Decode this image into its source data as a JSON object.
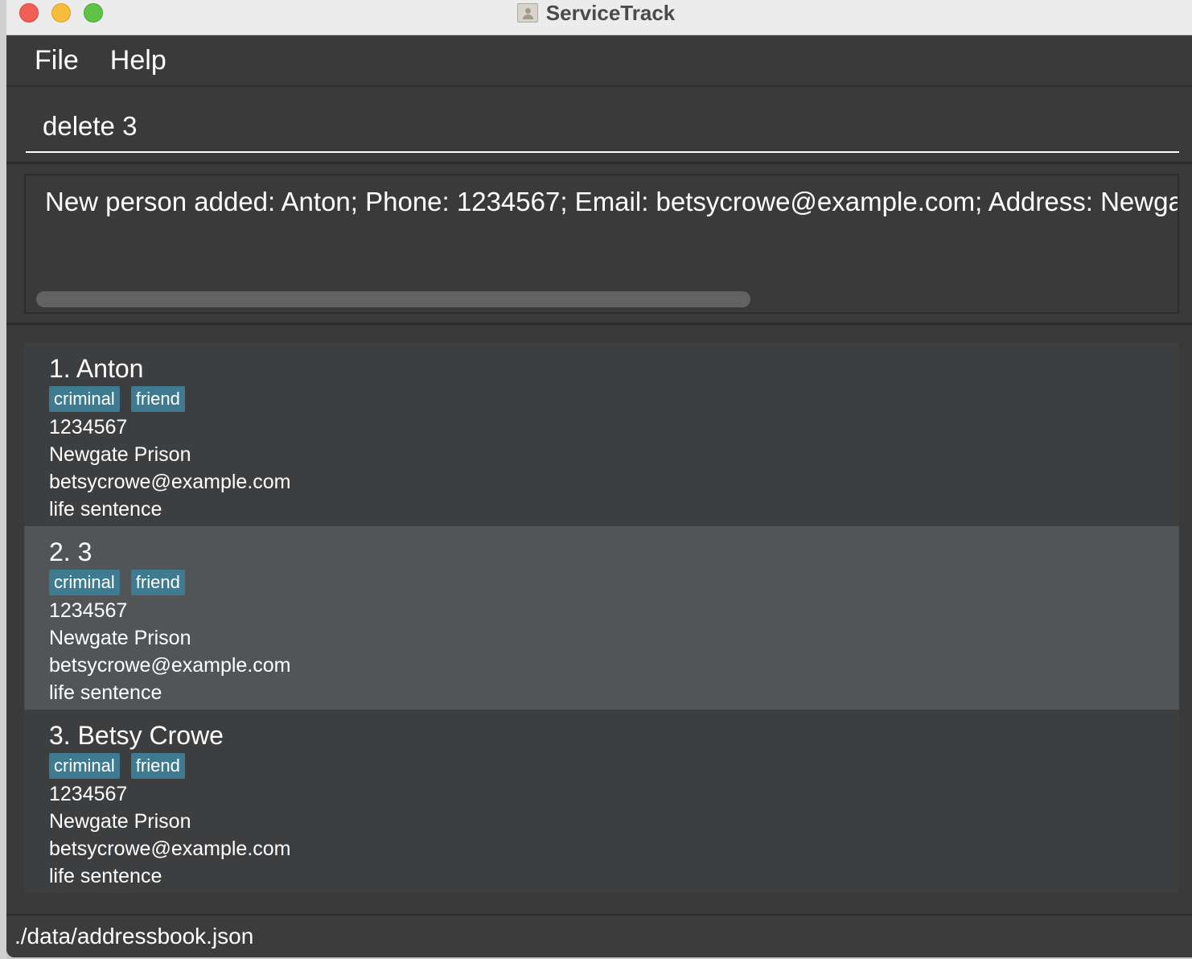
{
  "window": {
    "title": "ServiceTrack",
    "icon": "contacts-app-icon"
  },
  "menu": {
    "file": "File",
    "help": "Help"
  },
  "command": {
    "value": "delete 3"
  },
  "result": {
    "text": "New person added: Anton; Phone: 1234567; Email: betsycrowe@example.com; Address: Newgate Prison; Tags: [criminal][friend]"
  },
  "persons": [
    {
      "name": "1. Anton",
      "tags": [
        "criminal",
        "friend"
      ],
      "phone": "1234567",
      "address": "Newgate Prison",
      "email": "betsycrowe@example.com",
      "remark": "life sentence"
    },
    {
      "name": "2. 3",
      "tags": [
        "criminal",
        "friend"
      ],
      "phone": "1234567",
      "address": "Newgate Prison",
      "email": "betsycrowe@example.com",
      "remark": "life sentence"
    },
    {
      "name": "3. Betsy Crowe",
      "tags": [
        "criminal",
        "friend"
      ],
      "phone": "1234567",
      "address": "Newgate Prison",
      "email": "betsycrowe@example.com",
      "remark": "life sentence"
    }
  ],
  "status": {
    "path": "./data/addressbook.json"
  },
  "colors": {
    "background": "#3a3a3a",
    "selected_card": "#525558",
    "tag": "#3e7b91",
    "text": "#ffffff"
  }
}
